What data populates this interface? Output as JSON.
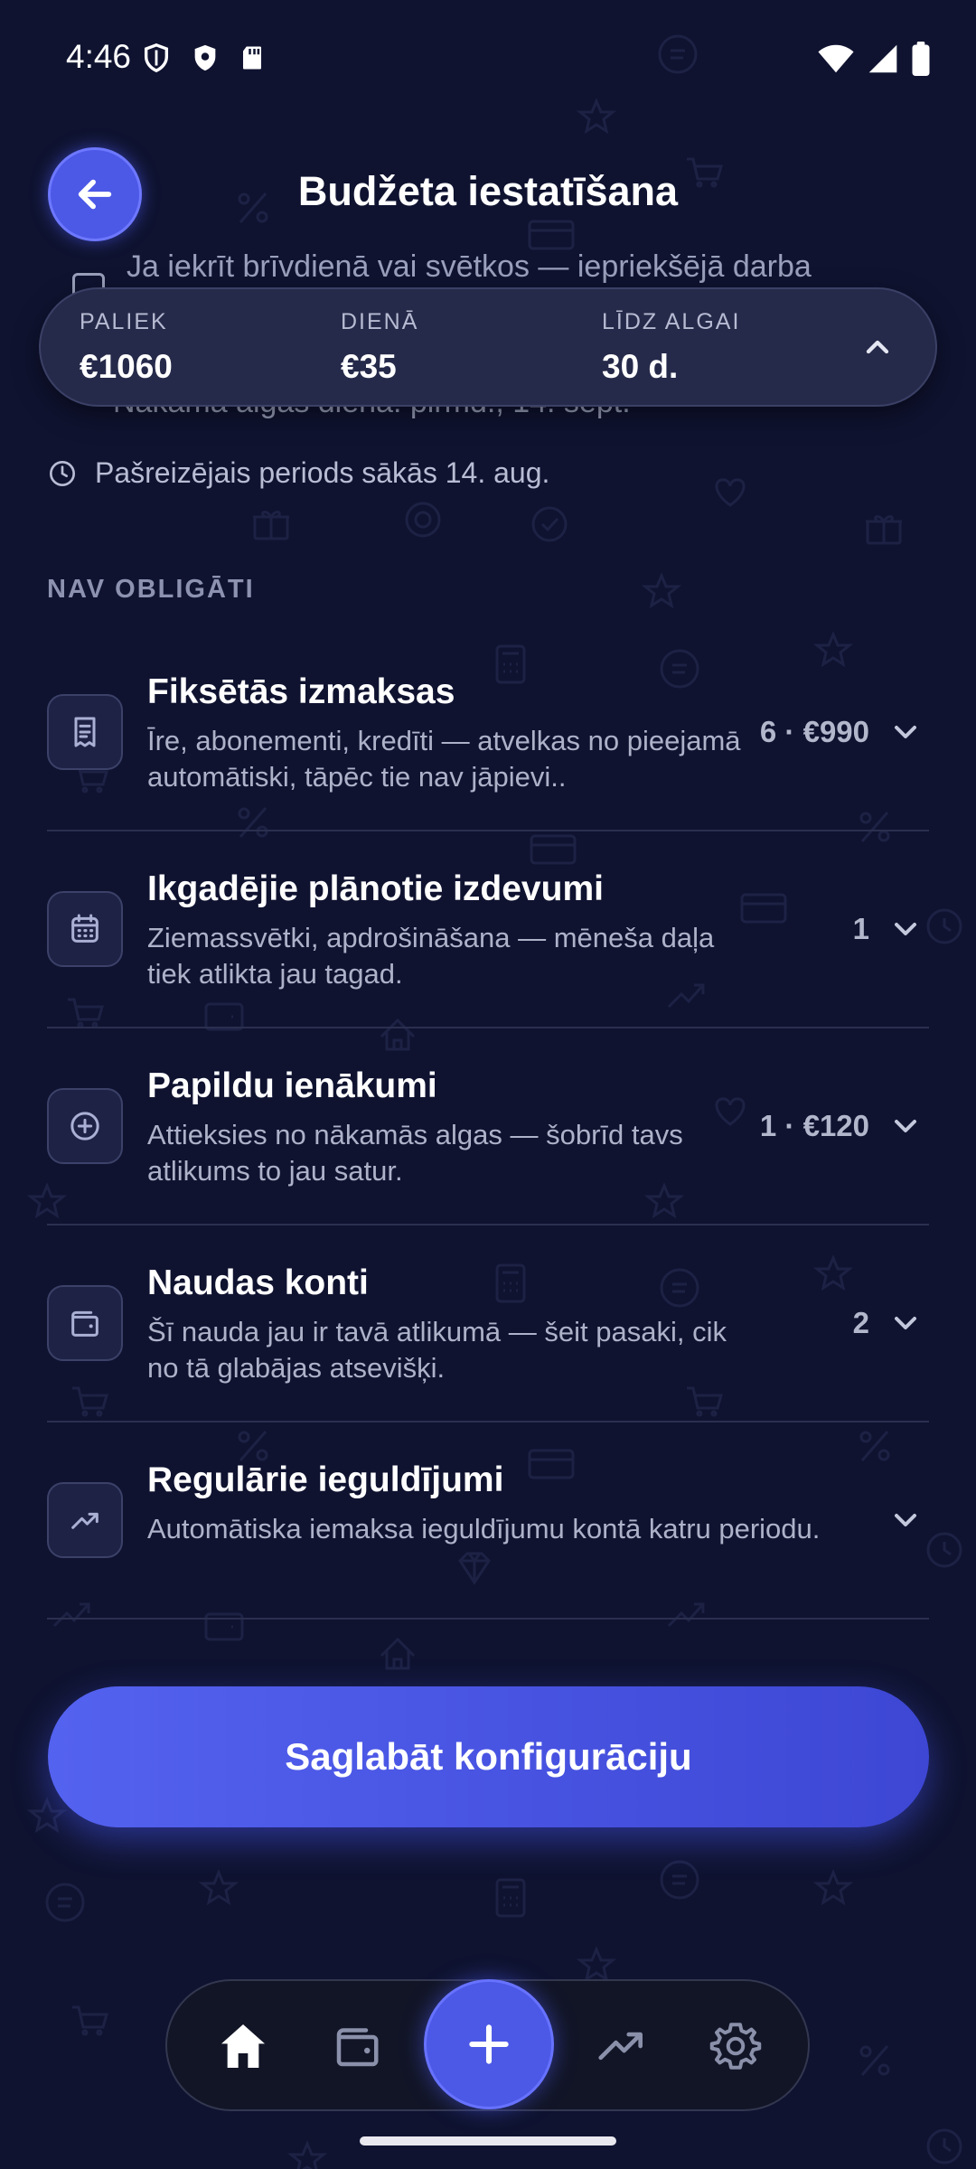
{
  "status_bar": {
    "time": "4:46"
  },
  "header": {
    "title": "Budžeta iestatīšana"
  },
  "behind_summary": {
    "line1": "Ja iekrīt brīvdienā vai svētkos — iepriekšējā darba",
    "line2": "Nākamā algas diena: pirmd., 14. sept."
  },
  "summary": {
    "items": [
      {
        "label": "PALIEK",
        "value": "€1060"
      },
      {
        "label": "DIENĀ",
        "value": "€35"
      },
      {
        "label": "LĪDZ ALGAI",
        "value": "30 d."
      }
    ]
  },
  "period": {
    "text": "Pašreizējais periods sākās 14. aug."
  },
  "section": {
    "label": "NAV OBLIGĀTI"
  },
  "rows": [
    {
      "icon": "receipt-icon",
      "title": "Fiksētās izmaksas",
      "desc": "Īre, abonementi, kredīti — atvelkas no pieejamā automātiski, tāpēc tie nav jāpievi..",
      "count": "6 · €990"
    },
    {
      "icon": "calendar-icon",
      "title": "Ikgadējie plānotie izdevumi",
      "desc": "Ziemassvētki, apdrošināšana — mēneša daļa tiek atlikta jau tagad.",
      "count": "1"
    },
    {
      "icon": "plus-circle-icon",
      "title": "Papildu ienākumi",
      "desc": "Attieksies no nākamās algas — šobrīd tavs atlikums to jau satur.",
      "count": "1 · €120"
    },
    {
      "icon": "wallet-icon",
      "title": "Naudas konti",
      "desc": "Šī nauda jau ir tavā atlikumā — šeit pasaki, cik no tā glabājas atsevišķi.",
      "count": "2"
    },
    {
      "icon": "trend-up-icon",
      "title": "Regulārie ieguldījumi",
      "desc": "Automātiska iemaksa ieguldījumu kontā katru periodu.",
      "count": ""
    }
  ],
  "save": {
    "label": "Saglabāt konfigurāciju"
  },
  "nav": {
    "items": [
      "home-icon",
      "wallet-icon",
      "add-icon",
      "trend-up-icon",
      "gear-icon"
    ]
  },
  "colors": {
    "background": "#0f1330",
    "accent": "#4c58e6",
    "card": "#262a4a"
  }
}
